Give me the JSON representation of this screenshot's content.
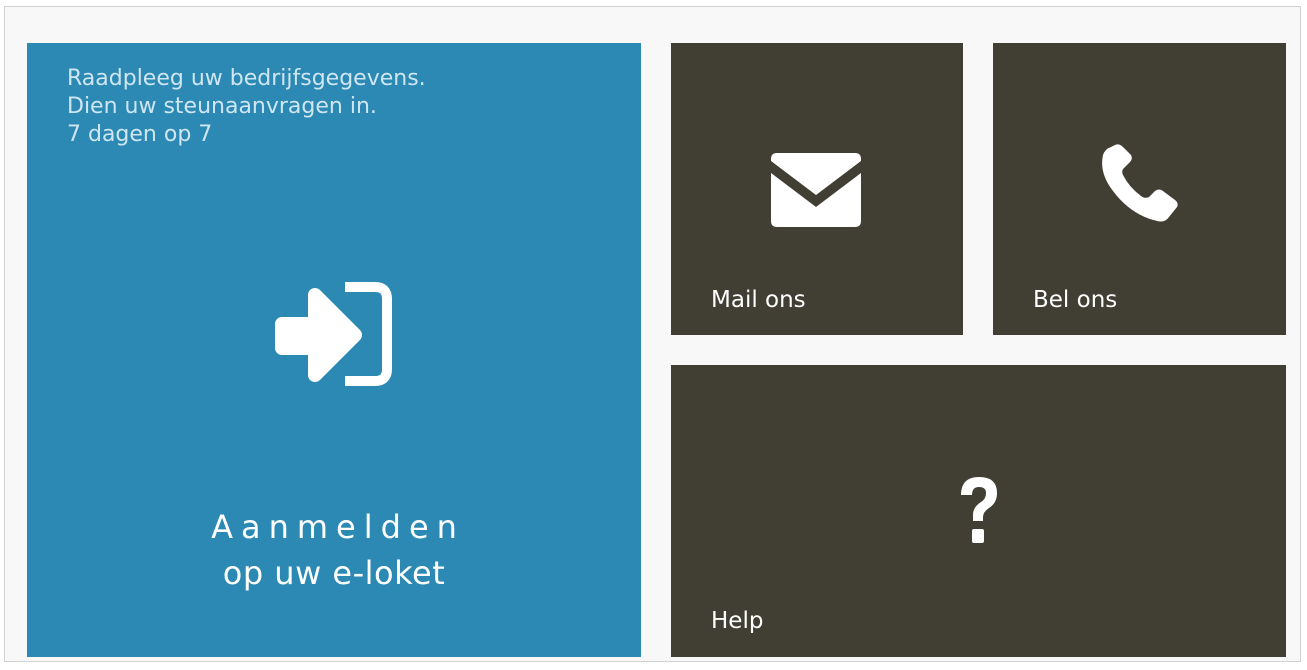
{
  "login_tile": {
    "intro_lines": [
      "Raadpleeg uw bedrijfsgegevens.",
      "Dien uw steunaanvragen in.",
      "7 dagen op 7"
    ],
    "title_line1": "Aanmelden",
    "title_line2": "op uw e-loket",
    "icon": "sign-in-icon",
    "color": "#2b89b4"
  },
  "mail_tile": {
    "label": "Mail ons",
    "icon": "envelope-icon",
    "color": "#413f33"
  },
  "phone_tile": {
    "label": "Bel ons",
    "icon": "phone-icon",
    "color": "#413f33"
  },
  "help_tile": {
    "label": "Help",
    "icon": "question-mark-icon",
    "color": "#413f33"
  }
}
